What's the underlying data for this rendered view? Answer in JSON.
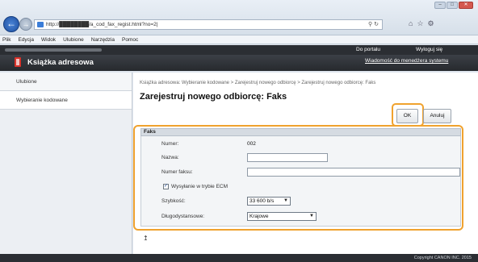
{
  "browser": {
    "url": "http://████████/a_cod_fax_regist.html?no=2|",
    "window_buttons": [
      "–",
      "□",
      "✕"
    ]
  },
  "menu": {
    "items": [
      "Plik",
      "Edycja",
      "Widok",
      "Ulubione",
      "Narzędzia",
      "Pomoc"
    ]
  },
  "header": {
    "app_title": "Książka adresowa",
    "portal_link": "Do portalu",
    "logout_link": "Wyloguj się",
    "admin_message_link": "Wiadomość do menedżera systemu"
  },
  "sidebar": {
    "items": [
      {
        "label": "Ulubione"
      },
      {
        "label": "Wybieranie kodowane"
      }
    ]
  },
  "main": {
    "breadcrumb": "Książka adresowa: Wybieranie kodowane > Zarejestruj nowego odbiorcę > Zarejestruj nowego odbiorcę: Faks",
    "page_title": "Zarejestruj nowego odbiorcę: Faks",
    "ok_label": "OK",
    "cancel_label": "Anuluj"
  },
  "form": {
    "section_title": "Faks",
    "number_label": "Numer:",
    "number_value": "002",
    "name_label": "Nazwa:",
    "name_value": "",
    "fax_number_label": "Numer faksu:",
    "fax_number_value": "",
    "ecm_label": "Wysyłanie w trybie ECM",
    "ecm_checked": true,
    "speed_label": "Szybkość:",
    "speed_value": "33 600 b/s",
    "long_distance_label": "Długodystansowe:",
    "long_distance_value": "Krajowe"
  },
  "footer": {
    "copyright": "Copyright CANON INC. 2015"
  },
  "colors": {
    "highlight": "#f0a22e",
    "header_bg": "#2b2e33",
    "logo_red": "#d9332b"
  },
  "icons": [
    "back-arrow-icon",
    "forward-arrow-icon",
    "favicon-icon",
    "search-icon",
    "refresh-icon",
    "home-icon",
    "star-icon",
    "gear-icon",
    "checkbox-check-icon",
    "chevron-down-icon",
    "anchor-icon"
  ]
}
